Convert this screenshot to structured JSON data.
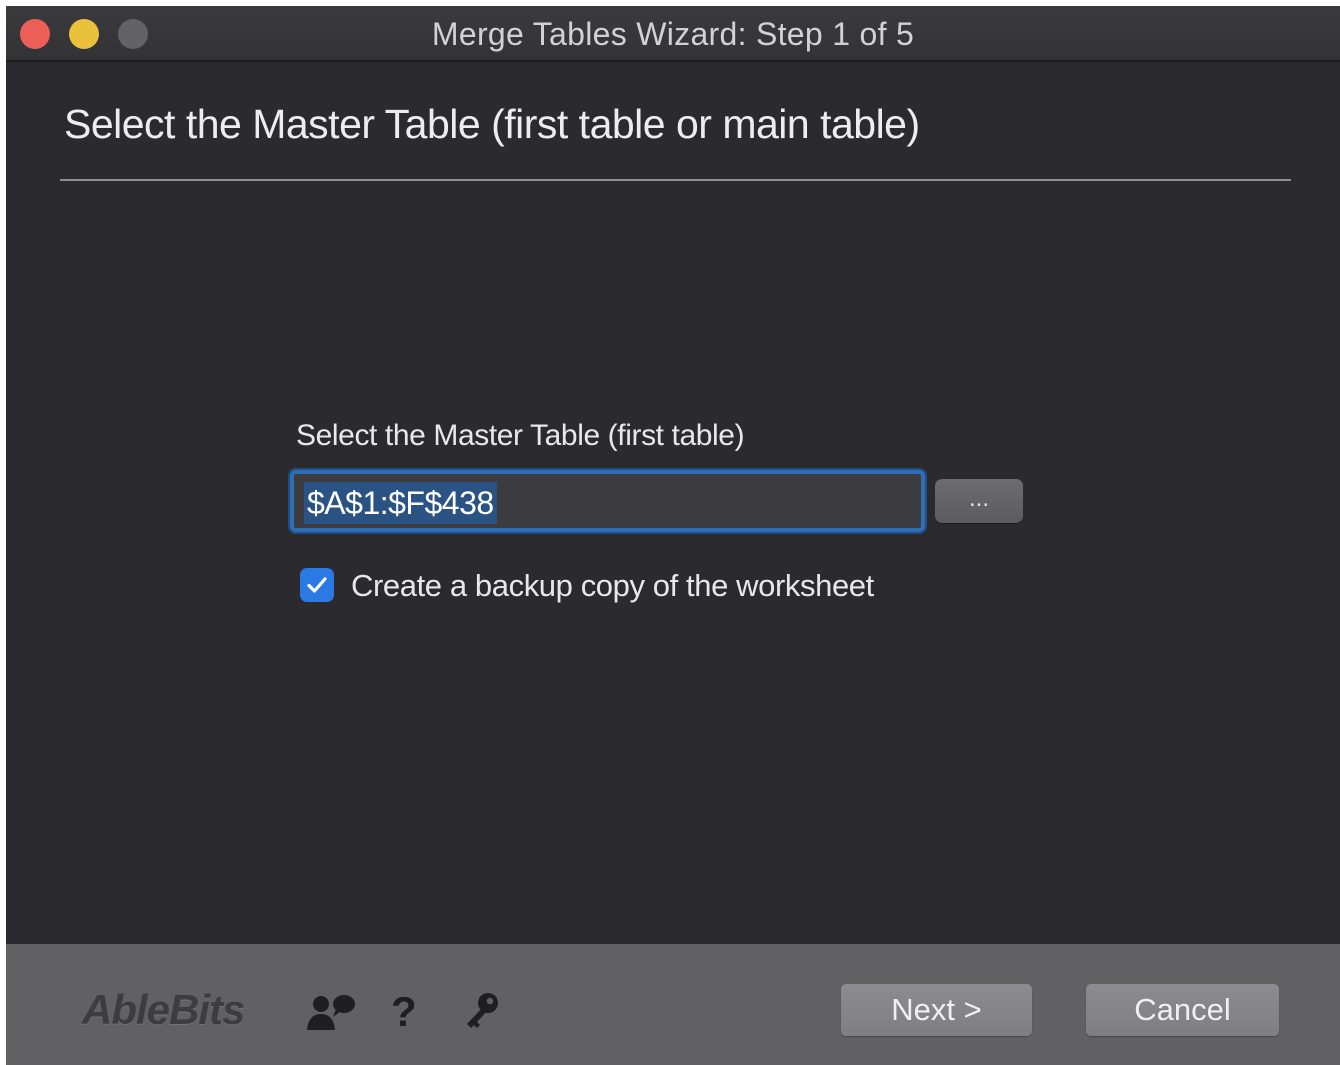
{
  "window": {
    "title": "Merge Tables Wizard: Step 1 of 5",
    "traffic_light_colors": {
      "close": "#ec5f57",
      "minimize": "#e9c13a",
      "zoom": "#636367"
    }
  },
  "main": {
    "heading": "Select the Master Table (first table or main table)",
    "field_label": "Select the Master Table (first table)",
    "range_value": "$A$1:$F$438",
    "browse_button_label": "...",
    "backup_checkbox": {
      "checked": true,
      "label": "Create a backup copy of the worksheet"
    }
  },
  "footer": {
    "logo_text": "AbleBits",
    "icons": [
      "community-icon",
      "help-icon",
      "key-icon"
    ],
    "help_glyph": "?",
    "next_label": "Next >",
    "cancel_label": "Cancel"
  },
  "colors": {
    "accent": "#2f6eb3",
    "checkbox": "#2b79e3",
    "background": "#2a2a2f",
    "footer": "#616164"
  }
}
